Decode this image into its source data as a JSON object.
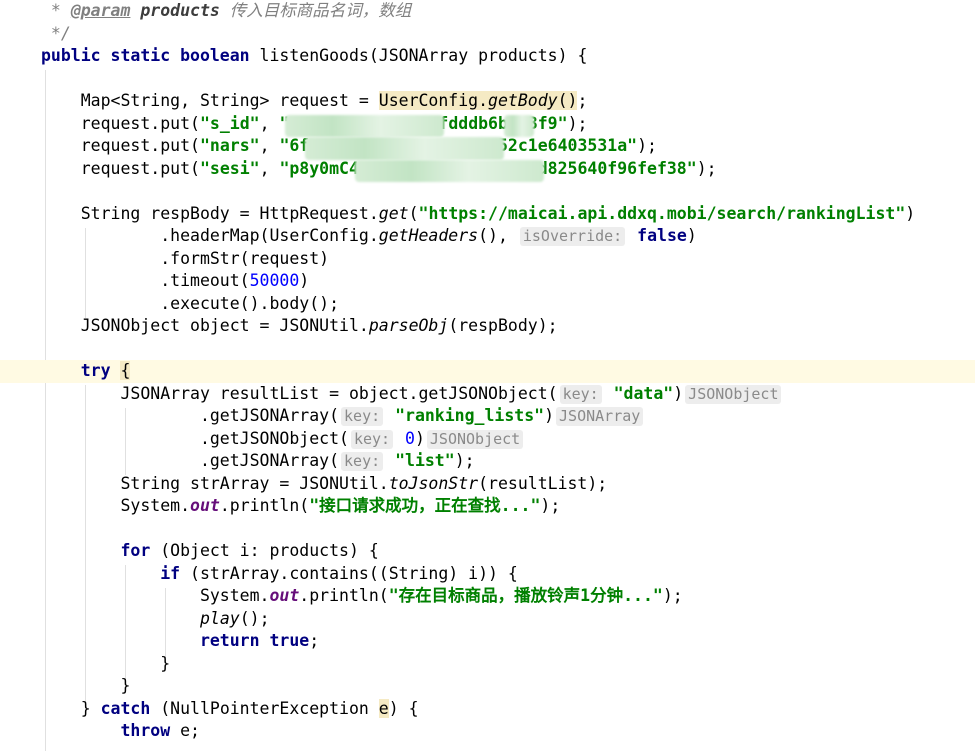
{
  "doc": {
    "c0": " * ",
    "c0_tag": "@param",
    "c0_name": " products",
    "c0_desc": " 传入目标商品名词，数组",
    "c1": " */",
    "l2_kw": "public static boolean",
    "l2_rest": " listenGoods(JSONArray products) {",
    "l4_a": "    Map<String, String> request = ",
    "l4_b": "UserConfig.",
    "l4_c": "getBody",
    "l4_d": "()",
    "l4_e": ";",
    "l5_a": "    request.put(",
    "l5_b": "\"s_id\"",
    "l5_c": ", ",
    "l5_d": "\"",
    "l5_e": "fdddb6b",
    "l5_f": "3f9\"",
    "l5_g": ");",
    "l6_a": "    request.put(",
    "l6_b": "\"nars\"",
    "l6_c": ", ",
    "l6_d": "\"6f",
    "l6_e": "52c1e6403531a\"",
    "l6_f": ");",
    "l7_a": "    request.put(",
    "l7_b": "\"sesi\"",
    "l7_c": ", ",
    "l7_d": "\"p8y0mC4",
    "l7_e": "d825640f96fef38\"",
    "l7_f": ");",
    "l9_a": "    String respBody = HttpRequest.",
    "l9_b": "get",
    "l9_c": "(",
    "l9_d": "\"https://maicai.api.ddxq.mobi/search/rankingList\"",
    "l9_e": ")",
    "l10_a": "            .headerMap(UserConfig.",
    "l10_b": "getHeaders",
    "l10_c": "(), ",
    "l10_hint": "isOverride:",
    "l10_d": " false",
    "l10_e": ")",
    "l11": "            .formStr(request)",
    "l12_a": "            .timeout(",
    "l12_b": "50000",
    "l12_c": ")",
    "l13": "            .execute().body();",
    "l14_a": "    JSONObject object = JSONUtil.",
    "l14_b": "parseObj",
    "l14_c": "(respBody);",
    "l16_a": "    try",
    "l16_b": " ",
    "l16_c": "{",
    "l17_a": "        JSONArray resultList = object.getJSONObject(",
    "l17_hint": "key:",
    "l17_b": " \"data\"",
    "l17_c": ")",
    "l17_type": "JSONObject",
    "l18_a": "                .getJSONArray(",
    "l18_hint": "key:",
    "l18_b": " \"ranking_lists\"",
    "l18_c": ")",
    "l18_type": "JSONArray",
    "l19_a": "                .getJSONObject(",
    "l19_hint": "key:",
    "l19_b": " 0",
    "l19_c": ")",
    "l19_type": "JSONObject",
    "l20_a": "                .getJSONArray(",
    "l20_hint": "key:",
    "l20_b": " \"list\"",
    "l20_c": ");",
    "l21_a": "        String strArray = JSONUtil.",
    "l21_b": "toJsonStr",
    "l21_c": "(resultList);",
    "l22_a": "        System.",
    "l22_b": "out",
    "l22_c": ".println(",
    "l22_d": "\"接口请求成功，正在查找...\"",
    "l22_e": ");",
    "l24_a": "        for",
    "l24_b": " (Object i: products) {",
    "l25_a": "            if",
    "l25_b": " (strArray.contains((String) i)) {",
    "l26_a": "                System.",
    "l26_b": "out",
    "l26_c": ".println(",
    "l26_d": "\"存在目标商品，播放铃声1分钟...\"",
    "l26_e": ");",
    "l27_a": "                ",
    "l27_b": "play",
    "l27_c": "();",
    "l28_a": "                return",
    "l28_b": " true",
    "l28_c": ";",
    "l29": "            }",
    "l30": "        }",
    "l31_a": "    } ",
    "l31_b": "catch",
    "l31_c": " (NullPointerException ",
    "l31_d": "e",
    "l31_e": ") {",
    "l32_a": "        throw",
    "l32_b": " e;"
  }
}
